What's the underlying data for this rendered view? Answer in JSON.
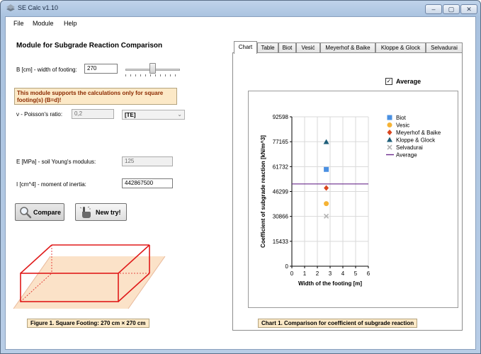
{
  "window": {
    "title": "SE Calc v1.10",
    "btn_min": "–",
    "btn_max": "▢",
    "btn_close": "✕"
  },
  "menu": {
    "file": "File",
    "module": "Module",
    "help": "Help"
  },
  "module_title": "Module for Subgrade Reaction Comparison",
  "width_input": {
    "label": "B [cm] - width of footing:",
    "value": "270"
  },
  "slider": {
    "level_fraction": 0.46
  },
  "note": "This module  supports the calculations only for square footing(s) (B=d)!",
  "poisson": {
    "label": "ν - Poisson's ratio:",
    "value": "0,2",
    "selected": "[TE]"
  },
  "youngs": {
    "label": "E [MPa] - soil Young's modulus:",
    "value": "125"
  },
  "inertia": {
    "label": "I [cm^4] - moment of inertia:",
    "value": "442867500"
  },
  "buttons": {
    "compare": "Compare",
    "new_try": "New try!"
  },
  "figure_caption": "Figure 1. Square Footing: 270 cm × 270 cm",
  "tabs": [
    "Chart",
    "Table",
    "Biot",
    "Vesić",
    "Meyerhof & Baike",
    "Kloppe & Glock",
    "Selvadurai"
  ],
  "average_checkbox": {
    "label": "Average",
    "checked": true,
    "mark": "✓"
  },
  "chart_caption": "Chart 1. Comparison for coefficient of subgrade reaction",
  "colors": {
    "biot": "#4a90e2",
    "vesic": "#f5b335",
    "meyerhof": "#d9461f",
    "kloppe": "#1f5f7a",
    "selvadurai": "#b3b3b3",
    "average": "#6a2a8c",
    "note_bg": "#fce9c7"
  },
  "chart_data": {
    "type": "scatter",
    "xlabel": "Width of the footing [m]",
    "ylabel": "Coefficient of subgrade reaction [kN/m^3]",
    "xlim": [
      0,
      6
    ],
    "ylim": [
      0,
      92598
    ],
    "xticks": [
      "0",
      "1",
      "2",
      "3",
      "4",
      "5",
      "6"
    ],
    "yticks": [
      "0",
      "15433",
      "30866",
      "46299",
      "61732",
      "77165",
      "92598"
    ],
    "grid": true,
    "legend": "top-right",
    "series": [
      {
        "name": "Biot",
        "marker": "square",
        "x": [
          2.7
        ],
        "y": [
          60000
        ]
      },
      {
        "name": "Vesic",
        "marker": "circle",
        "x": [
          2.7
        ],
        "y": [
          38800
        ]
      },
      {
        "name": "Meyerhof & Baike",
        "marker": "diamond",
        "x": [
          2.7
        ],
        "y": [
          48500
        ]
      },
      {
        "name": "Kloppe & Glock",
        "marker": "triangle",
        "x": [
          2.7
        ],
        "y": [
          77000
        ]
      },
      {
        "name": "Selvadurai",
        "marker": "x",
        "x": [
          2.7
        ],
        "y": [
          31000
        ]
      }
    ],
    "average": {
      "name": "Average",
      "y": 51000
    }
  }
}
